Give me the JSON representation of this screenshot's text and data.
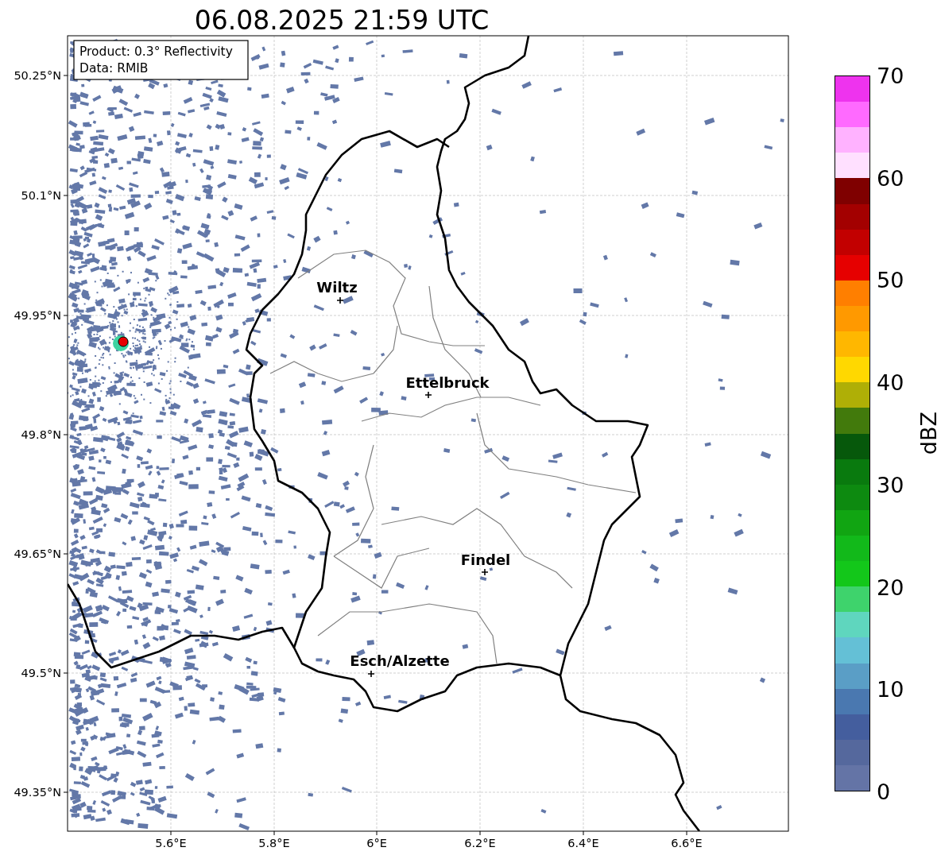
{
  "title": "06.08.2025 21:59 UTC",
  "info_box": [
    "Product: 0.3° Reflectivity",
    "Data: RMIB"
  ],
  "y_ticks": [
    "50.25°N",
    "50.1°N",
    "49.95°N",
    "49.8°N",
    "49.65°N",
    "49.5°N",
    "49.35°N"
  ],
  "x_ticks": [
    "5.6°E",
    "5.8°E",
    "6°E",
    "6.2°E",
    "6.4°E",
    "6.6°E"
  ],
  "cities": [
    {
      "name": "Wiltz"
    },
    {
      "name": "Ettelbruck"
    },
    {
      "name": "Findel"
    },
    {
      "name": "Esch/Alzette"
    }
  ],
  "colorbar": {
    "label": "dBZ",
    "ticks": [
      "70",
      "60",
      "50",
      "40",
      "30",
      "20",
      "10",
      "0"
    ],
    "segments": [
      {
        "color": "#ee33ee"
      },
      {
        "color": "#ff6aff"
      },
      {
        "color": "#ffb2ff"
      },
      {
        "color": "#ffe0ff"
      },
      {
        "color": "#7f0000"
      },
      {
        "color": "#a30000"
      },
      {
        "color": "#c20000"
      },
      {
        "color": "#e60000"
      },
      {
        "color": "#ff7f00"
      },
      {
        "color": "#ff9900"
      },
      {
        "color": "#ffb700"
      },
      {
        "color": "#ffd800"
      },
      {
        "color": "#afaf06"
      },
      {
        "color": "#427a0c"
      },
      {
        "color": "#06580b"
      },
      {
        "color": "#097a0e"
      },
      {
        "color": "#0d8a10"
      },
      {
        "color": "#11a512"
      },
      {
        "color": "#12b91a"
      },
      {
        "color": "#13c71a"
      },
      {
        "color": "#3ed36c"
      },
      {
        "color": "#5fd6be"
      },
      {
        "color": "#64c0d6"
      },
      {
        "color": "#5a9ec6"
      },
      {
        "color": "#4a78b0"
      },
      {
        "color": "#445e9e"
      },
      {
        "color": "#55689d"
      },
      {
        "color": "#6474a6"
      }
    ]
  }
}
